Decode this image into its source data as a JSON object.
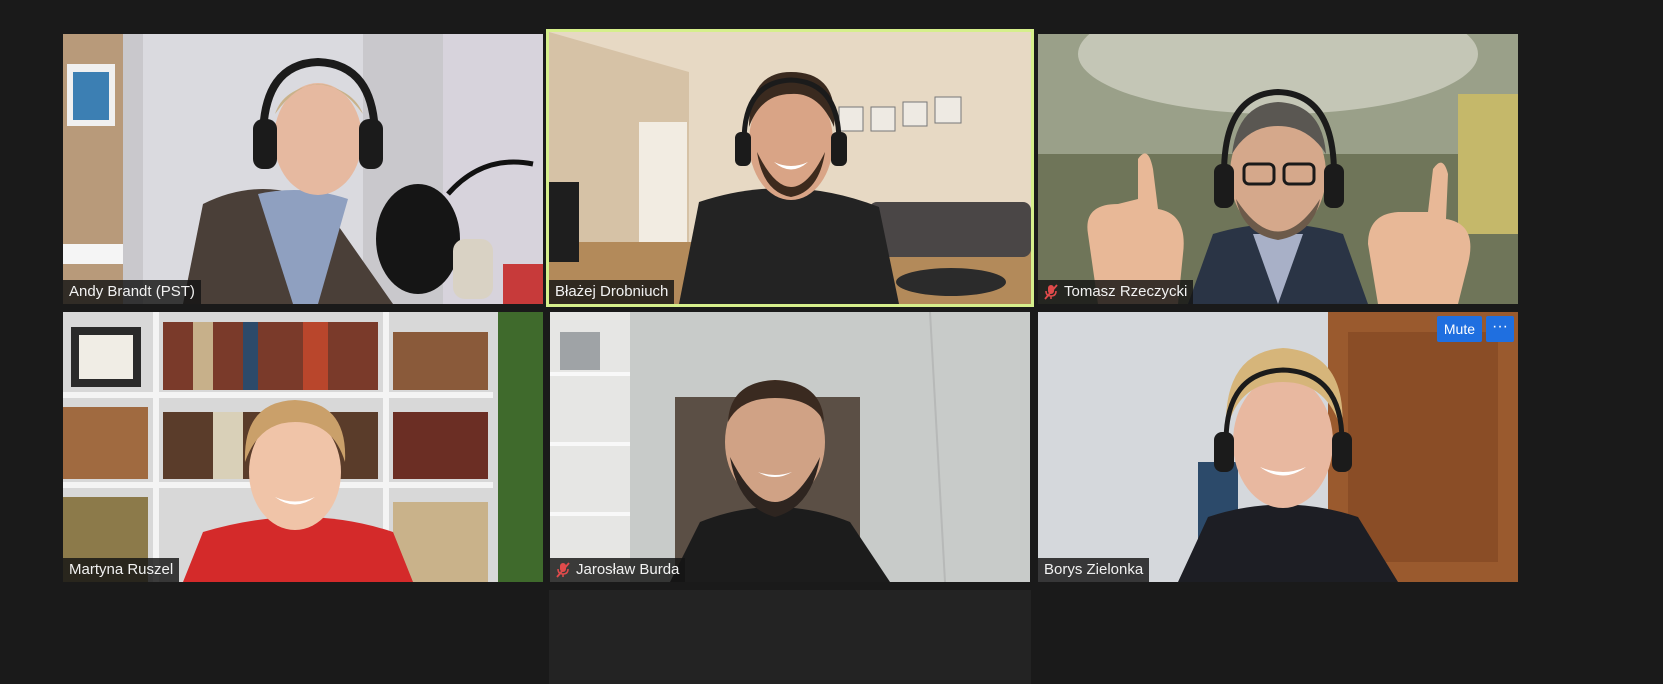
{
  "participants": [
    {
      "name": "Andy Brandt (PST)",
      "muted": false,
      "active_speaker": false
    },
    {
      "name": "Błażej Drobniuch",
      "muted": false,
      "active_speaker": true
    },
    {
      "name": "Tomasz Rzeczycki",
      "muted": true,
      "active_speaker": false
    },
    {
      "name": "Martyna Ruszel",
      "muted": false,
      "active_speaker": false
    },
    {
      "name": "Jarosław Burda",
      "muted": true,
      "active_speaker": false
    },
    {
      "name": "Borys Zielonka",
      "muted": false,
      "active_speaker": false
    }
  ],
  "hover_controls": {
    "mute_label": "Mute",
    "more_label": "···"
  },
  "colors": {
    "background": "#1a1a1a",
    "active_speaker_border": "#d6ef8c",
    "button_blue": "#1f6fe0",
    "muted_mic_red": "#e04b4b"
  }
}
